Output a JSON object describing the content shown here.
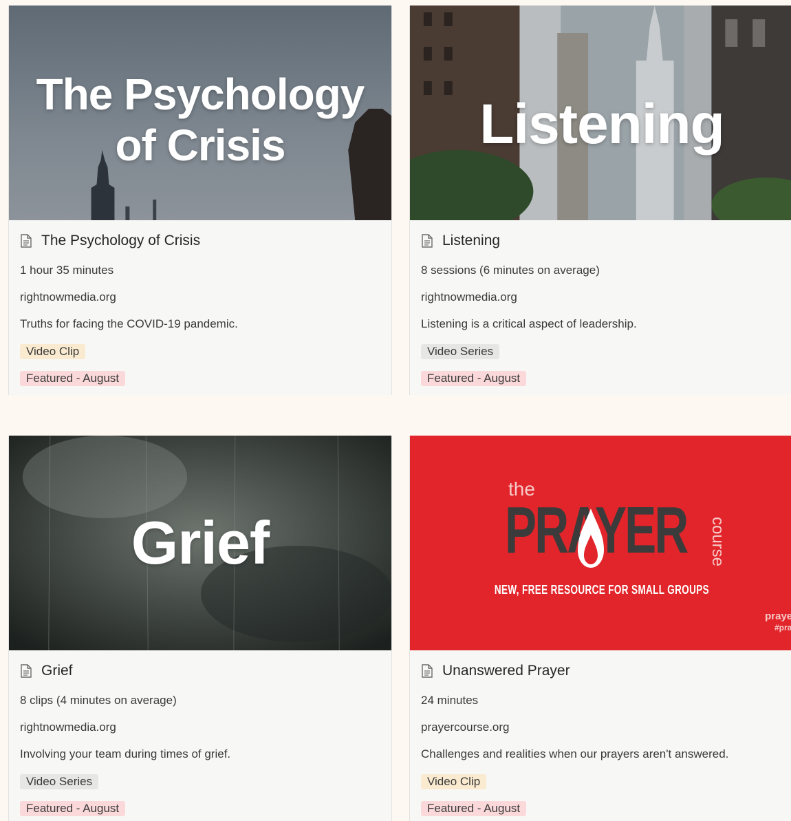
{
  "cards": [
    {
      "cover_text": [
        "The Psychology",
        "of Crisis"
      ],
      "title": "The Psychology of Crisis",
      "duration": "1 hour 35 minutes",
      "source": "rightnowmedia.org",
      "description": "Truths for facing the COVID-19 pandemic.",
      "type_tag": "Video Clip",
      "type_color": "#faebd0",
      "feature_tag": "Featured - August",
      "feature_color": "#fbd9da"
    },
    {
      "cover_text": [
        "Listening"
      ],
      "title": "Listening",
      "duration": "8 sessions (6 minutes on average)",
      "source": "rightnowmedia.org",
      "description": "Listening is a critical aspect of leadership.",
      "type_tag": "Video Series",
      "type_color": "#e6e6e4",
      "feature_tag": "Featured - August",
      "feature_color": "#fbd9da"
    },
    {
      "cover_text": [
        "Grief"
      ],
      "title": "Grief",
      "duration": "8 clips (4 minutes on average)",
      "source": "rightnowmedia.org",
      "description": "Involving your team during times of grief.",
      "type_tag": "Video Series",
      "type_color": "#e6e6e4",
      "feature_tag": "Featured - August",
      "feature_color": "#fbd9da"
    },
    {
      "cover_text": {
        "the": "the",
        "prayer": "PRAYER",
        "course": "course",
        "subtitle": "NEW, FREE RESOURCE FOR SMALL GROUPS",
        "corner_line1": "prayer",
        "corner_line2": "#pray"
      },
      "title": "Unanswered Prayer",
      "duration": "24 minutes",
      "source": "prayercourse.org",
      "description": "Challenges and realities when our prayers aren't answered.",
      "type_tag": "Video Clip",
      "type_color": "#faebd0",
      "feature_tag": "Featured - August",
      "feature_color": "#fbd9da"
    }
  ],
  "icons": {
    "page": "document-icon"
  },
  "colors": {
    "background": "#fdf8f1",
    "prayer_red": "#e2252a"
  }
}
